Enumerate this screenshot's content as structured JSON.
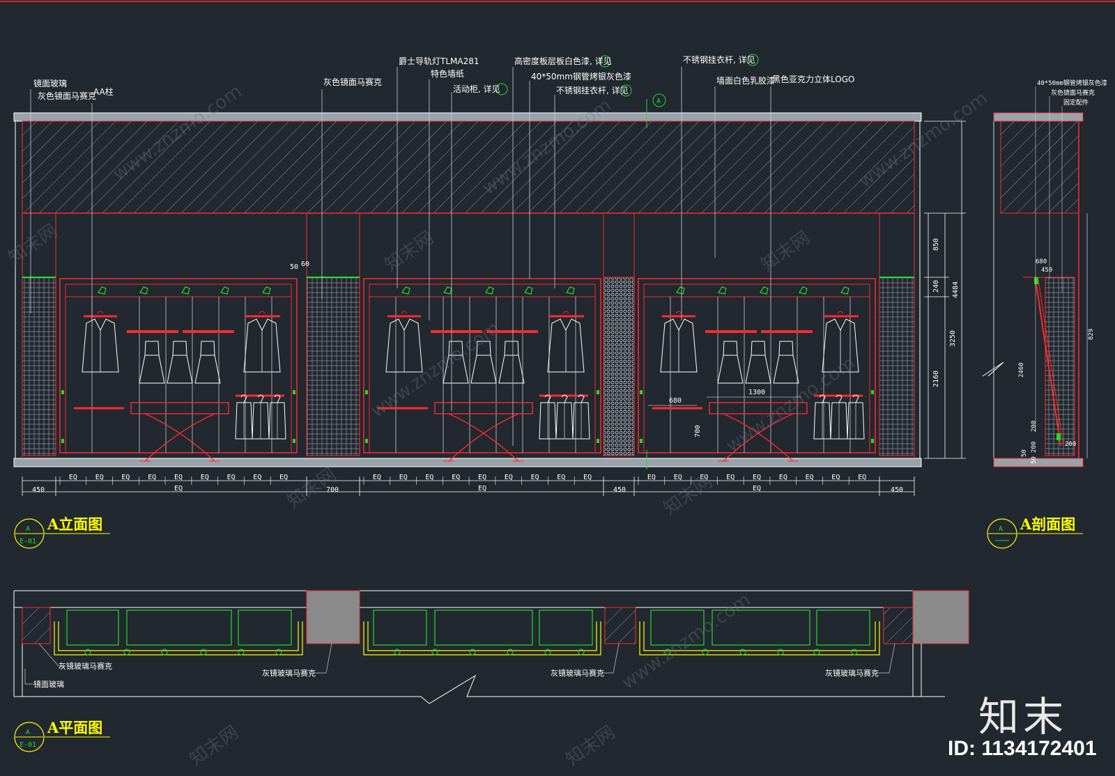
{
  "elevation": {
    "callouts": [
      "镜面玻璃",
      "灰色镜面马赛克",
      "AA柱",
      "灰色镜面马赛克",
      "爵士导轨灯TLMA281",
      "特色墙纸",
      "活动柜, 详见",
      "高密度板层板白色漆, 详见",
      "40*50mm钢管烤银灰色漆",
      "不锈钢挂衣杆, 详见",
      "不锈钢挂衣杆, 详见",
      "墙面白色乳胶漆",
      "黑色亚克力立体LOGO"
    ],
    "right_dims": [
      "850",
      "240",
      "3250",
      "2160",
      "4484"
    ],
    "small_dims": [
      "50",
      "60",
      "680",
      "1300",
      "700"
    ],
    "bottom_eq": "EQ",
    "bottom_dims": [
      "450",
      "700",
      "450",
      "450"
    ],
    "section_symbol": "A"
  },
  "section": {
    "callouts": [
      "40*50mm钢管烤银灰色漆",
      "灰色镜面马赛克",
      "固定配件"
    ],
    "dims": [
      "680",
      "450",
      "2460",
      "200",
      "200",
      "50",
      "50",
      "200",
      "829"
    ]
  },
  "plan": {
    "callouts": [
      "灰镜玻璃马赛克",
      "镜面玻璃",
      "灰镜玻璃马赛克",
      "灰镜玻璃马赛克",
      "灰镜玻璃马赛克"
    ]
  },
  "titles": {
    "elevation": "A立面图",
    "section": "A剖面图",
    "plan": "A平面图",
    "tag_letter": "A",
    "tag_sheet": "E-01"
  },
  "watermark": {
    "brand": "知末",
    "id": "ID: 1134172401",
    "url": "www.znzmo.com",
    "site": "知末网"
  },
  "colors": {
    "background": "#212830",
    "red": "#ff2a2a",
    "green": "#22dd22",
    "yellow": "#ffff00",
    "white": "#ffffff"
  }
}
